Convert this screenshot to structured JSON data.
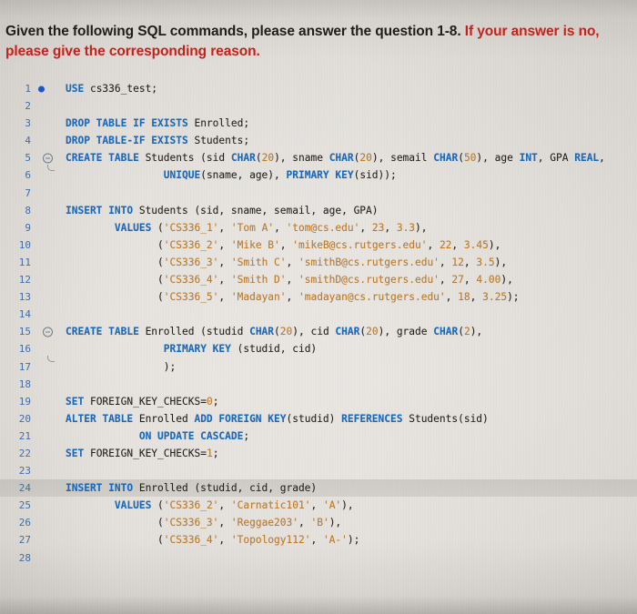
{
  "prompt": {
    "black_part": "Given the following SQL commands, please answer the question 1-8.",
    "red_part": "If your answer is no, please give the corresponding reason."
  },
  "editor": {
    "language": "SQL",
    "colors": {
      "keyword": "#1769c0",
      "literal": "#bf7b28",
      "identifier": "#24201c",
      "line_number": "#3f6fa8",
      "breakpoint": "#1b55c8",
      "highlight_row": "#a6a4a0",
      "background": "#e4e0db"
    },
    "breakpoint_line": 1,
    "fold_lines": [
      5,
      15
    ],
    "highlighted_line": 24,
    "lines": [
      {
        "n": "1",
        "tokens": [
          {
            "t": "kw",
            "v": "USE"
          },
          {
            "t": "id",
            "v": " cs336_test;"
          }
        ]
      },
      {
        "n": "2",
        "tokens": []
      },
      {
        "n": "3",
        "tokens": [
          {
            "t": "kw",
            "v": "DROP TABLE IF EXISTS"
          },
          {
            "t": "id",
            "v": " Enrolled;"
          }
        ]
      },
      {
        "n": "4",
        "tokens": [
          {
            "t": "kw",
            "v": "DROP TABLE-IF EXISTS"
          },
          {
            "t": "id",
            "v": " Students;"
          }
        ]
      },
      {
        "n": "5",
        "tokens": [
          {
            "t": "kw",
            "v": "CREATE TABLE"
          },
          {
            "t": "id",
            "v": " Students (sid "
          },
          {
            "t": "kw",
            "v": "CHAR"
          },
          {
            "t": "id",
            "v": "("
          },
          {
            "t": "lit",
            "v": "20"
          },
          {
            "t": "id",
            "v": "), sname "
          },
          {
            "t": "kw",
            "v": "CHAR"
          },
          {
            "t": "id",
            "v": "("
          },
          {
            "t": "lit",
            "v": "20"
          },
          {
            "t": "id",
            "v": "), semail "
          },
          {
            "t": "kw",
            "v": "CHAR"
          },
          {
            "t": "id",
            "v": "("
          },
          {
            "t": "lit",
            "v": "50"
          },
          {
            "t": "id",
            "v": "), age "
          },
          {
            "t": "kw",
            "v": "INT"
          },
          {
            "t": "id",
            "v": ", GPA "
          },
          {
            "t": "kw",
            "v": "REAL"
          },
          {
            "t": "id",
            "v": ","
          }
        ]
      },
      {
        "n": "6",
        "tokens": [
          {
            "t": "id",
            "v": "                "
          },
          {
            "t": "kw",
            "v": "UNIQUE"
          },
          {
            "t": "id",
            "v": "(sname, age), "
          },
          {
            "t": "kw",
            "v": "PRIMARY KEY"
          },
          {
            "t": "id",
            "v": "(sid));"
          }
        ]
      },
      {
        "n": "7",
        "tokens": []
      },
      {
        "n": "8",
        "tokens": [
          {
            "t": "kw",
            "v": "INSERT INTO"
          },
          {
            "t": "id",
            "v": " Students (sid, sname, semail, age, GPA)"
          }
        ]
      },
      {
        "n": "9",
        "tokens": [
          {
            "t": "id",
            "v": "        "
          },
          {
            "t": "kw",
            "v": "VALUES"
          },
          {
            "t": "id",
            "v": " ("
          },
          {
            "t": "lit",
            "v": "'CS336_1'"
          },
          {
            "t": "id",
            "v": ", "
          },
          {
            "t": "lit",
            "v": "'Tom A'"
          },
          {
            "t": "id",
            "v": ", "
          },
          {
            "t": "lit",
            "v": "'tom@cs.edu'"
          },
          {
            "t": "id",
            "v": ", "
          },
          {
            "t": "lit",
            "v": "23"
          },
          {
            "t": "id",
            "v": ", "
          },
          {
            "t": "lit",
            "v": "3.3"
          },
          {
            "t": "id",
            "v": "),"
          }
        ]
      },
      {
        "n": "10",
        "tokens": [
          {
            "t": "id",
            "v": "               ("
          },
          {
            "t": "lit",
            "v": "'CS336_2'"
          },
          {
            "t": "id",
            "v": ", "
          },
          {
            "t": "lit",
            "v": "'Mike B'"
          },
          {
            "t": "id",
            "v": ", "
          },
          {
            "t": "lit",
            "v": "'mikeB@cs.rutgers.edu'"
          },
          {
            "t": "id",
            "v": ", "
          },
          {
            "t": "lit",
            "v": "22"
          },
          {
            "t": "id",
            "v": ", "
          },
          {
            "t": "lit",
            "v": "3.45"
          },
          {
            "t": "id",
            "v": "),"
          }
        ]
      },
      {
        "n": "11",
        "tokens": [
          {
            "t": "id",
            "v": "               ("
          },
          {
            "t": "lit",
            "v": "'CS336_3'"
          },
          {
            "t": "id",
            "v": ", "
          },
          {
            "t": "lit",
            "v": "'Smith C'"
          },
          {
            "t": "id",
            "v": ", "
          },
          {
            "t": "lit",
            "v": "'smithB@cs.rutgers.edu'"
          },
          {
            "t": "id",
            "v": ", "
          },
          {
            "t": "lit",
            "v": "12"
          },
          {
            "t": "id",
            "v": ", "
          },
          {
            "t": "lit",
            "v": "3.5"
          },
          {
            "t": "id",
            "v": "),"
          }
        ]
      },
      {
        "n": "12",
        "tokens": [
          {
            "t": "id",
            "v": "               ("
          },
          {
            "t": "lit",
            "v": "'CS336_4'"
          },
          {
            "t": "id",
            "v": ", "
          },
          {
            "t": "lit",
            "v": "'Smith D'"
          },
          {
            "t": "id",
            "v": ", "
          },
          {
            "t": "lit",
            "v": "'smithD@cs.rutgers.edu'"
          },
          {
            "t": "id",
            "v": ", "
          },
          {
            "t": "lit",
            "v": "27"
          },
          {
            "t": "id",
            "v": ", "
          },
          {
            "t": "lit",
            "v": "4.00"
          },
          {
            "t": "id",
            "v": "),"
          }
        ]
      },
      {
        "n": "13",
        "tokens": [
          {
            "t": "id",
            "v": "               ("
          },
          {
            "t": "lit",
            "v": "'CS336_5'"
          },
          {
            "t": "id",
            "v": ", "
          },
          {
            "t": "lit",
            "v": "'Madayan'"
          },
          {
            "t": "id",
            "v": ", "
          },
          {
            "t": "lit",
            "v": "'madayan@cs.rutgers.edu'"
          },
          {
            "t": "id",
            "v": ", "
          },
          {
            "t": "lit",
            "v": "18"
          },
          {
            "t": "id",
            "v": ", "
          },
          {
            "t": "lit",
            "v": "3.25"
          },
          {
            "t": "id",
            "v": ");"
          }
        ]
      },
      {
        "n": "14",
        "tokens": []
      },
      {
        "n": "15",
        "tokens": [
          {
            "t": "kw",
            "v": "CREATE TABLE"
          },
          {
            "t": "id",
            "v": " Enrolled (studid "
          },
          {
            "t": "kw",
            "v": "CHAR"
          },
          {
            "t": "id",
            "v": "("
          },
          {
            "t": "lit",
            "v": "20"
          },
          {
            "t": "id",
            "v": "), cid "
          },
          {
            "t": "kw",
            "v": "CHAR"
          },
          {
            "t": "id",
            "v": "("
          },
          {
            "t": "lit",
            "v": "20"
          },
          {
            "t": "id",
            "v": "), grade "
          },
          {
            "t": "kw",
            "v": "CHAR"
          },
          {
            "t": "id",
            "v": "("
          },
          {
            "t": "lit",
            "v": "2"
          },
          {
            "t": "id",
            "v": "),"
          }
        ]
      },
      {
        "n": "16",
        "tokens": [
          {
            "t": "id",
            "v": "                "
          },
          {
            "t": "kw",
            "v": "PRIMARY KEY"
          },
          {
            "t": "id",
            "v": " (studid, cid)"
          }
        ]
      },
      {
        "n": "17",
        "tokens": [
          {
            "t": "id",
            "v": "                );"
          }
        ]
      },
      {
        "n": "18",
        "tokens": []
      },
      {
        "n": "19",
        "tokens": [
          {
            "t": "kw",
            "v": "SET"
          },
          {
            "t": "id",
            "v": " FOREIGN_KEY_CHECKS="
          },
          {
            "t": "lit",
            "v": "0"
          },
          {
            "t": "id",
            "v": ";"
          }
        ]
      },
      {
        "n": "20",
        "tokens": [
          {
            "t": "kw",
            "v": "ALTER TABLE"
          },
          {
            "t": "id",
            "v": " Enrolled "
          },
          {
            "t": "kw",
            "v": "ADD FOREIGN KEY"
          },
          {
            "t": "id",
            "v": "(studid) "
          },
          {
            "t": "kw",
            "v": "REFERENCES"
          },
          {
            "t": "id",
            "v": " Students(sid)"
          }
        ]
      },
      {
        "n": "21",
        "tokens": [
          {
            "t": "id",
            "v": "            "
          },
          {
            "t": "kw",
            "v": "ON UPDATE CASCADE"
          },
          {
            "t": "id",
            "v": ";"
          }
        ]
      },
      {
        "n": "22",
        "tokens": [
          {
            "t": "kw",
            "v": "SET"
          },
          {
            "t": "id",
            "v": " FOREIGN_KEY_CHECKS="
          },
          {
            "t": "lit",
            "v": "1"
          },
          {
            "t": "id",
            "v": ";"
          }
        ]
      },
      {
        "n": "23",
        "tokens": []
      },
      {
        "n": "24",
        "tokens": [
          {
            "t": "kw",
            "v": "INSERT INTO"
          },
          {
            "t": "id",
            "v": " Enrolled (studid, cid, grade)"
          }
        ]
      },
      {
        "n": "25",
        "tokens": [
          {
            "t": "id",
            "v": "        "
          },
          {
            "t": "kw",
            "v": "VALUES"
          },
          {
            "t": "id",
            "v": " ("
          },
          {
            "t": "lit",
            "v": "'CS336_2'"
          },
          {
            "t": "id",
            "v": ", "
          },
          {
            "t": "lit",
            "v": "'Carnatic101'"
          },
          {
            "t": "id",
            "v": ", "
          },
          {
            "t": "lit",
            "v": "'A'"
          },
          {
            "t": "id",
            "v": "),"
          }
        ]
      },
      {
        "n": "26",
        "tokens": [
          {
            "t": "id",
            "v": "               ("
          },
          {
            "t": "lit",
            "v": "'CS336_3'"
          },
          {
            "t": "id",
            "v": ", "
          },
          {
            "t": "lit",
            "v": "'Reggae203'"
          },
          {
            "t": "id",
            "v": ", "
          },
          {
            "t": "lit",
            "v": "'B'"
          },
          {
            "t": "id",
            "v": "),"
          }
        ]
      },
      {
        "n": "27",
        "tokens": [
          {
            "t": "id",
            "v": "               ("
          },
          {
            "t": "lit",
            "v": "'CS336_4'"
          },
          {
            "t": "id",
            "v": ", "
          },
          {
            "t": "lit",
            "v": "'Topology112'"
          },
          {
            "t": "id",
            "v": ", "
          },
          {
            "t": "lit",
            "v": "'A-'"
          },
          {
            "t": "id",
            "v": ");"
          }
        ]
      },
      {
        "n": "28",
        "tokens": []
      }
    ]
  }
}
